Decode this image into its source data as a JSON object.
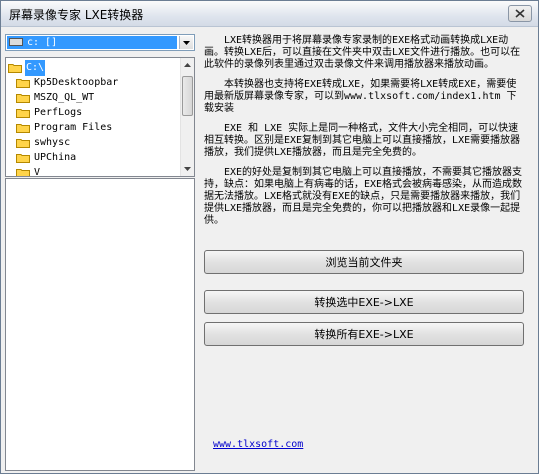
{
  "window": {
    "title": "屏幕录像专家 LXE转换器"
  },
  "drive": {
    "selected": "c: []"
  },
  "directories": [
    {
      "label": "C:\\",
      "selected": true,
      "open": true
    },
    {
      "label": "Kp5Desktoopbar",
      "selected": false,
      "open": false
    },
    {
      "label": "MSZQ_QL_WT",
      "selected": false,
      "open": false
    },
    {
      "label": "PerfLogs",
      "selected": false,
      "open": false
    },
    {
      "label": "Program Files",
      "selected": false,
      "open": false
    },
    {
      "label": "swhysc",
      "selected": false,
      "open": false
    },
    {
      "label": "UPChina",
      "selected": false,
      "open": false
    },
    {
      "label": "V",
      "selected": false,
      "open": false
    }
  ],
  "description": {
    "p1": "LXE转换器用于将屏幕录像专家录制的EXE格式动画转换成LXE动画。转换LXE后，可以直接在文件夹中双击LXE文件进行播放。也可以在此软件的录像列表里通过双击录像文件来调用播放器来播放动画。",
    "p2": "本转换器也支持将EXE转成LXE，如果需要将LXE转成EXE，需要使用最新版屏幕录像专家，可以到www.tlxsoft.com/index1.htm 下载安装",
    "p3": "EXE 和 LXE 实际上是同一种格式，文件大小完全相同，可以快速相互转换。区别是EXE复制到其它电脑上可以直接播放，LXE需要播放器播放，我们提供LXE播放器，而且是完全免费的。",
    "p4": "EXE的好处是复制到其它电脑上可以直接播放，不需要其它播放器支持，缺点：如果电脑上有病毒的话，EXE格式会被病毒感染，从而造成数据无法播放。LXE格式就没有EXE的缺点，只是需要播放器来播放，我们提供LXE播放器，而且是完全免费的，你可以把播放器和LXE录像一起提供。"
  },
  "buttons": {
    "browse": "浏览当前文件夹",
    "convert_selected": "转换选中EXE->LXE",
    "convert_all": "转换所有EXE->LXE"
  },
  "footer": {
    "link": "www.tlxsoft.com"
  },
  "colors": {
    "selection": "#3399ff",
    "folder": "#ffd44a",
    "link": "#0000cc"
  }
}
